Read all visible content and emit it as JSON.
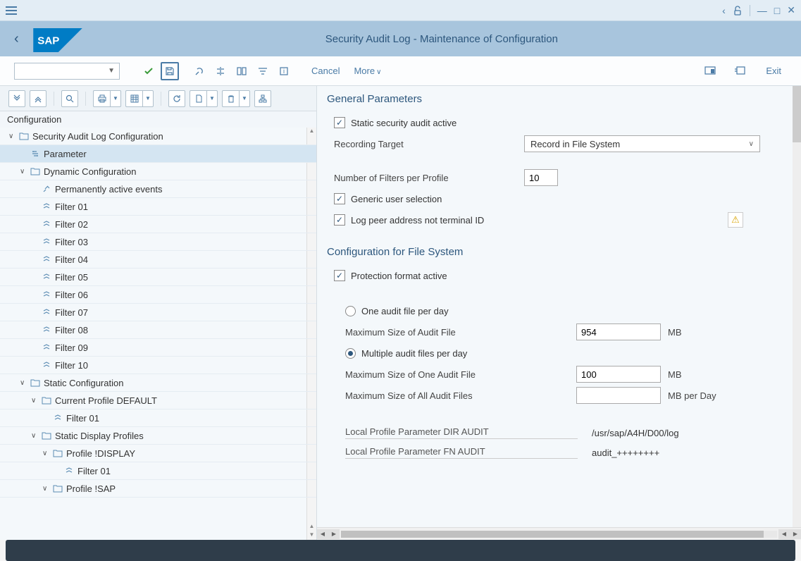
{
  "page_title": "Security Audit Log - Maintenance of Configuration",
  "toolbar": {
    "cancel": "Cancel",
    "more": "More",
    "exit": "Exit"
  },
  "config_header": "Configuration",
  "tree": {
    "root": "Security Audit Log Configuration",
    "parameter": "Parameter",
    "dynamic": "Dynamic Configuration",
    "perm_active": "Permanently active events",
    "f1": "Filter 01",
    "f2": "Filter 02",
    "f3": "Filter 03",
    "f4": "Filter 04",
    "f5": "Filter 05",
    "f6": "Filter 06",
    "f7": "Filter 07",
    "f8": "Filter 08",
    "f9": "Filter 09",
    "f10": "Filter 10",
    "static": "Static Configuration",
    "current_profile": "Current Profile DEFAULT",
    "cp_f1": "Filter 01",
    "static_display": "Static Display Profiles",
    "profile_display": "Profile !DISPLAY",
    "pd_f1": "Filter 01",
    "profile_sap": "Profile !SAP"
  },
  "general": {
    "title": "General Parameters",
    "static_audit": "Static security audit active",
    "recording_target_label": "Recording Target",
    "recording_target_value": "Record in File System",
    "num_filters_label": "Number of Filters per Profile",
    "num_filters_value": "10",
    "generic_user": "Generic user selection",
    "log_peer": "Log peer address not terminal ID"
  },
  "filesys": {
    "title": "Configuration for File System",
    "protection_format": "Protection format active",
    "one_per_day": "One audit file per day",
    "max_size_label": "Maximum Size of Audit File",
    "max_size_value": "954",
    "mb": "MB",
    "multiple_per_day": "Multiple audit files per day",
    "max_one_label": "Maximum Size of One Audit File",
    "max_one_value": "100",
    "max_all_label": "Maximum Size of All Audit Files",
    "max_all_value": "",
    "mb_per_day": "MB per Day",
    "dir_audit_label": "Local Profile Parameter DIR AUDIT",
    "dir_audit_value": "/usr/sap/A4H/D00/log",
    "fn_audit_label": "Local Profile Parameter FN AUDIT",
    "fn_audit_value": "audit_++++++++"
  }
}
